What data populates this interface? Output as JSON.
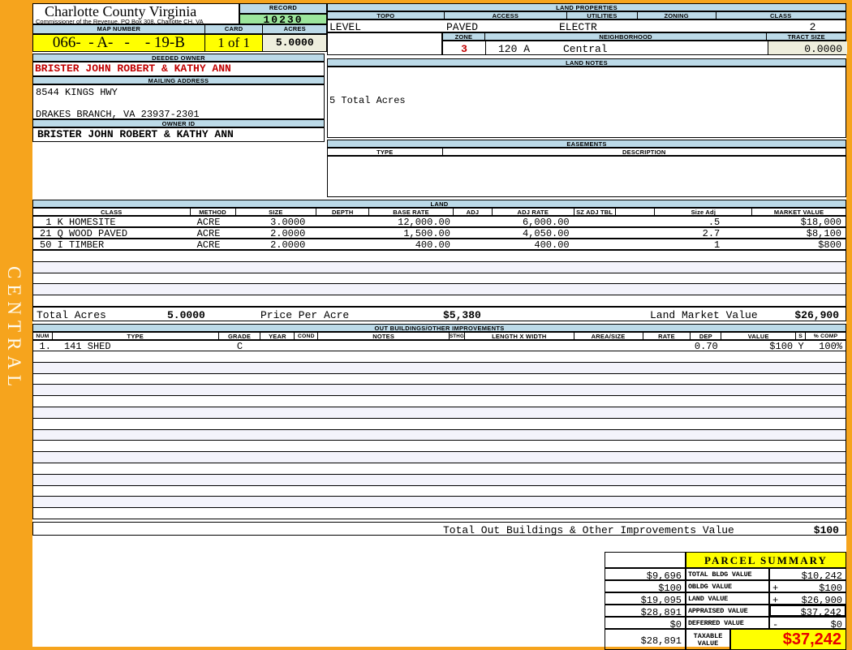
{
  "county": {
    "title": "Charlotte County Virginia",
    "subtitle": "Commissioner of the Revenue, PO Box 308, Charlotte CH, VA"
  },
  "record": {
    "label": "RECORD",
    "value": "10230"
  },
  "parcel": {
    "map_number_label": "MAP NUMBER",
    "map_number": "066-  - A-   -    - 19-B",
    "card_label": "CARD",
    "card": "1 of 1",
    "acres_label": "ACRES",
    "acres": "5.0000"
  },
  "owner": {
    "deeded_label": "DEEDED OWNER",
    "deeded": "BRISTER JOHN ROBERT & KATHY ANN",
    "mailing_label": "MAILING ADDRESS",
    "address_line1": "8544 KINGS HWY",
    "address_line2": "DRAKES BRANCH, VA 23937-2301",
    "owner_id_label": "OWNER ID",
    "owner_id": "BRISTER JOHN ROBERT & KATHY ANN"
  },
  "land_properties": {
    "title": "LAND PROPERTIES",
    "topo_label": "TOPO",
    "access_label": "ACCESS",
    "utilities_label": "UTILITIES",
    "zoning_label": "ZONING",
    "class_label": "CLASS",
    "topo": "LEVEL",
    "access": "PAVED",
    "utilities": "ELECTR",
    "zoning": "",
    "class": "2",
    "zone_label": "ZONE",
    "zone": "3",
    "neighborhood_label": "NEIGHBORHOOD",
    "neighborhood_code": "120 A",
    "neighborhood_name": "Central",
    "tract_size_label": "TRACT SIZE",
    "tract_size": "0.0000"
  },
  "land_notes": {
    "title": "LAND NOTES",
    "note": "5 Total Acres"
  },
  "easements": {
    "title": "EASEMENTS",
    "type_label": "TYPE",
    "description_label": "DESCRIPTION"
  },
  "land": {
    "title": "LAND",
    "headers": [
      "CLASS",
      "METHOD",
      "SIZE",
      "DEPTH",
      "BASE RATE",
      "ADJ",
      "ADJ RATE",
      "SZ ADJ TBL",
      "",
      "Size Adj",
      "MARKET VALUE"
    ],
    "rows": [
      {
        "class": " 1 K HOMESITE",
        "method": "ACRE",
        "size": "3.0000",
        "depth": "",
        "base_rate": "12,000.00",
        "adj": "",
        "adj_rate": "6,000.00",
        "sz_adj_tbl": "",
        "size_adj": ".5",
        "market_value": "$18,000"
      },
      {
        "class": "21 Q WOOD PAVED",
        "method": "ACRE",
        "size": "2.0000",
        "depth": "",
        "base_rate": "1,500.00",
        "adj": "",
        "adj_rate": "4,050.00",
        "sz_adj_tbl": "",
        "size_adj": "2.7",
        "market_value": "$8,100"
      },
      {
        "class": "50 I TIMBER",
        "method": "ACRE",
        "size": "2.0000",
        "depth": "",
        "base_rate": "400.00",
        "adj": "",
        "adj_rate": "400.00",
        "sz_adj_tbl": "",
        "size_adj": "1",
        "market_value": "$800"
      }
    ],
    "total_acres_label": "Total Acres",
    "total_acres": "5.0000",
    "price_per_acre_label": "Price Per Acre",
    "price_per_acre": "$5,380",
    "market_value_label": "Land Market Value",
    "market_value": "$26,900"
  },
  "out_buildings": {
    "title": "OUT BUILDINGS/OTHER IMPROVEMENTS",
    "headers": [
      "NUM",
      "TYPE",
      "GRADE",
      "YEAR",
      "COND",
      "NOTES",
      "STHGT",
      "LENGTH X WIDTH",
      "AREA/SIZE",
      "RATE",
      "DEP",
      "VALUE",
      "S",
      "% COMP"
    ],
    "rows": [
      {
        "num": "1.",
        "type": "141 SHED",
        "grade": "C",
        "year": "",
        "cond": "",
        "notes": "",
        "sthgt": "",
        "length_x_width": "",
        "area_size": "",
        "rate": "",
        "dep": "0.70",
        "value": "$100",
        "s": "Y",
        "pct_comp": "100%"
      }
    ],
    "total_label": "Total Out Buildings & Other Improvements Value",
    "total": "$100"
  },
  "parcel_summary": {
    "title": "PARCEL SUMMARY",
    "rows": [
      {
        "prior": "$9,696",
        "label": "TOTAL BLDG VALUE",
        "op": "",
        "value": "$10,242"
      },
      {
        "prior": "$100",
        "label": "OBLDG VALUE",
        "op": "+",
        "value": "$100"
      },
      {
        "prior": "$19,095",
        "label": "LAND VALUE",
        "op": "+",
        "value": "$26,900"
      },
      {
        "prior": "$28,891",
        "label": "APPRAISED VALUE",
        "op": "",
        "value": "$37,242"
      },
      {
        "prior": "$0",
        "label": "DEFERRED VALUE",
        "op": "-",
        "value": "$0"
      }
    ],
    "taxable": {
      "prior": "$28,891",
      "label_line1": "TAXABLE",
      "label_line2": "VALUE",
      "value": "$37,242"
    }
  },
  "watermark": "CENTRAL",
  "colors": {
    "frame_orange": "#f6a41d",
    "header_blue": "#bcdae8",
    "highlight_yellow": "#ffff00",
    "record_green": "#9ce69c",
    "acres_cream": "#eeeedd",
    "owner_red": "#c00000",
    "taxable_red": "#e60000",
    "filler_lavender": "#f3f3fb"
  }
}
